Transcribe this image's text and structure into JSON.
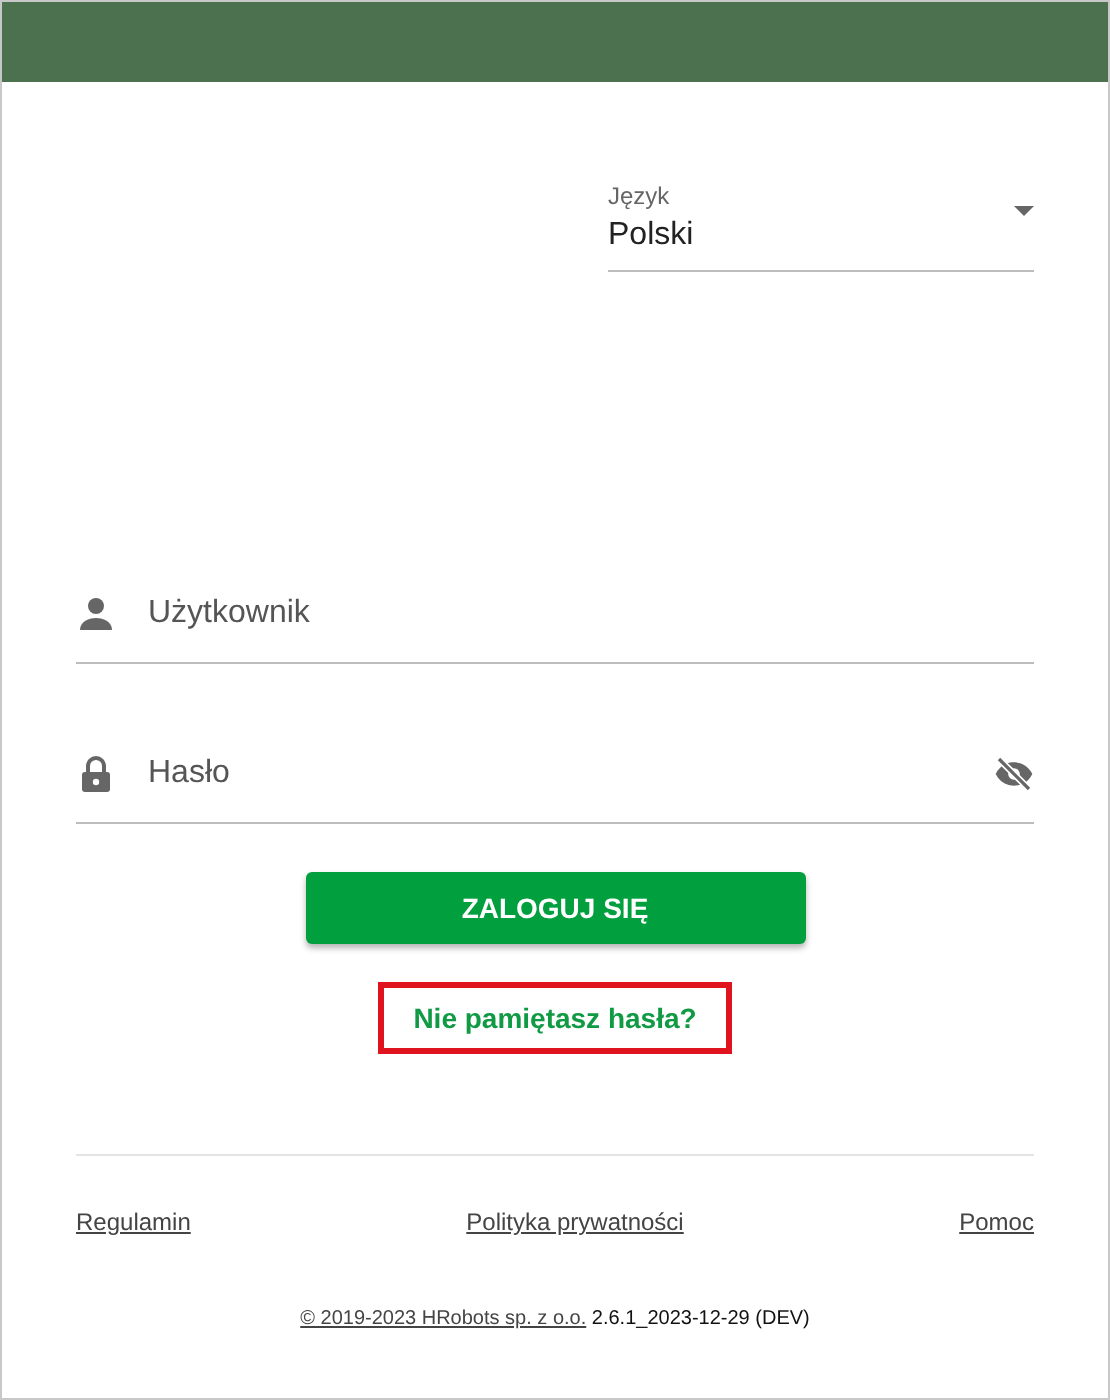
{
  "language": {
    "label": "Język",
    "value": "Polski"
  },
  "username": {
    "placeholder": "Użytkownik"
  },
  "password": {
    "placeholder": "Hasło",
    "visible": false
  },
  "login_button": {
    "label": "ZALOGUJ SIĘ"
  },
  "forgot_link": {
    "label": "Nie pamiętasz hasła?",
    "highlighted": true
  },
  "footer_links": [
    "Regulamin",
    "Polityka prywatności",
    "Pomoc"
  ],
  "copyright": {
    "link": "© 2019-2023 HRobots sp. z o.o.",
    "version": "2.6.1_2023-12-29 (DEV)"
  }
}
